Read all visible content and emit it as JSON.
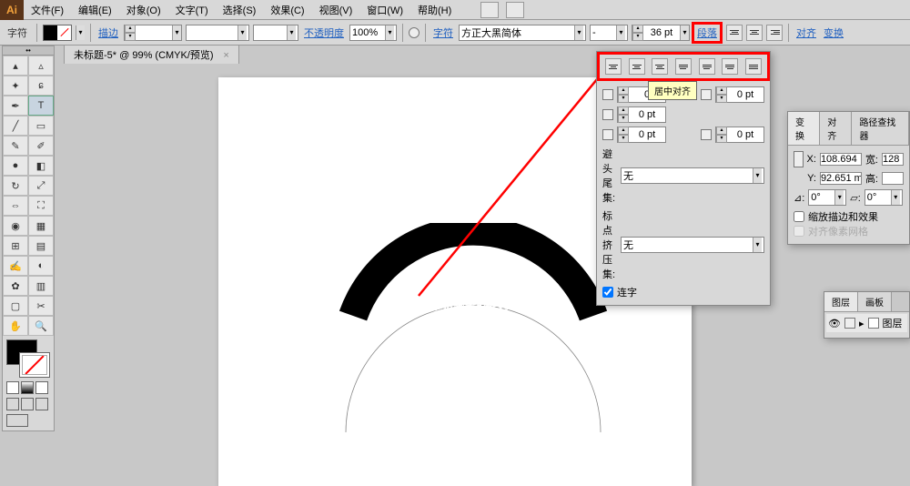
{
  "app": {
    "icon_text": "Ai"
  },
  "menu": {
    "file": "文件(F)",
    "edit": "编辑(E)",
    "object": "对象(O)",
    "type": "文字(T)",
    "select": "选择(S)",
    "effect": "效果(C)",
    "view": "视图(V)",
    "window": "窗口(W)",
    "help": "帮助(H)"
  },
  "toolbar": {
    "char_label": "字符",
    "stroke_label": "描边",
    "opacity_label": "不透明度",
    "opacity_value": "100%",
    "char_link": "字符",
    "font_family": "方正大黑简体",
    "font_style": "-",
    "font_size": "36 pt",
    "para_link": "段落",
    "align_link": "对齐",
    "transform_link": "变换"
  },
  "tab": {
    "title": "未标题-5* @ 99% (CMYK/预览)"
  },
  "canvas": {
    "path_text": "ai教程之路径文字"
  },
  "para_panel": {
    "tooltip": "居中对齐",
    "left_indent": "0",
    "right_indent": "0 pt",
    "first_line": "0 pt",
    "space_before": "0 pt",
    "space_after": "0 pt",
    "hyphen_label": "避头尾集:",
    "hyphen_value": "无",
    "compose_label": "标点挤压集:",
    "compose_value": "无",
    "ligature": "连字"
  },
  "trans_panel": {
    "tabs": {
      "t1": "变换",
      "t2": "对齐",
      "t3": "路径查找器"
    },
    "x_label": "X:",
    "x_value": "108.694",
    "w_label": "宽:",
    "w_value": "128",
    "y_label": "Y:",
    "y_value": "92.651 m",
    "h_label": "高:",
    "angle_label": "⊿:",
    "angle_value": "0°",
    "shear_label": "▱:",
    "shear_value": "0°",
    "scale_stroke": "缩放描边和效果",
    "align_pixel": "对齐像素网格"
  },
  "layer_panel": {
    "tabs": {
      "t1": "图层",
      "t2": "画板"
    },
    "layer_name": "图层"
  }
}
